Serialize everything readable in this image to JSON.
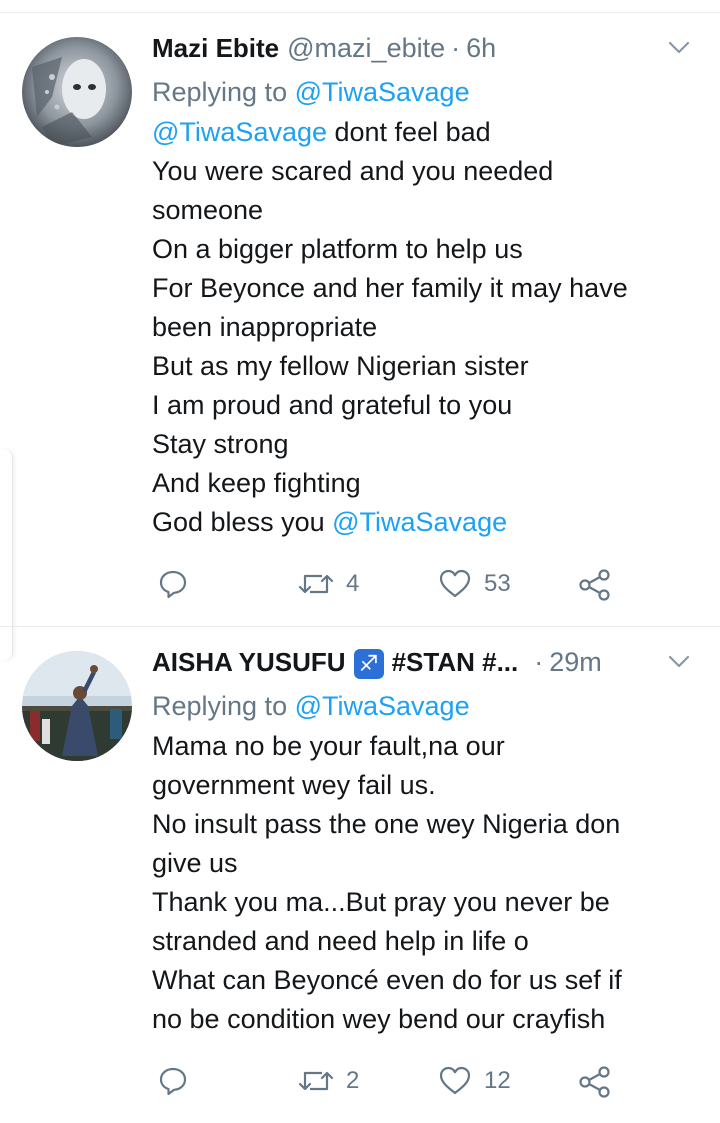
{
  "tweets": [
    {
      "name": "Mazi Ebite",
      "handle": "@mazi_ebite",
      "dot": "·",
      "time": "6h",
      "reply_prefix": "Replying to ",
      "reply_handle": "@TiwaSavage",
      "lines": [
        {
          "mention": "@TiwaSavage",
          "text": " dont feel bad"
        },
        {
          "text": "You were scared and you needed"
        },
        {
          "text": "someone"
        },
        {
          "text": "On a bigger platform to help us"
        },
        {
          "text": "For Beyonce and her family it may have"
        },
        {
          "text": "been inappropriate"
        },
        {
          "text": "But as my fellow Nigerian sister"
        },
        {
          "text": "I am proud and grateful to you"
        },
        {
          "text": "Stay strong"
        },
        {
          "text": "And keep fighting"
        },
        {
          "text": "God bless you ",
          "mention_after": "@TiwaSavage"
        }
      ],
      "retweets": "4",
      "likes": "53"
    },
    {
      "name": "AISHA YUSUFU",
      "name_badge": "♐",
      "name_suffix": "#STAN #...",
      "dot": "·",
      "time": "29m",
      "reply_prefix": "Replying to ",
      "reply_handle": "@TiwaSavage",
      "lines": [
        {
          "text": "Mama no be your fault,na our"
        },
        {
          "text": "government wey fail us."
        },
        {
          "text": "No insult pass the one wey Nigeria don"
        },
        {
          "text": "give us"
        },
        {
          "text": "Thank you ma...But pray you never be"
        },
        {
          "text": "stranded and need help in life o"
        },
        {
          "text": "What can Beyoncé even do for us sef if"
        },
        {
          "text": "no be condition wey bend our crayfish"
        }
      ],
      "retweets": "2",
      "likes": "12"
    }
  ],
  "colors": {
    "link": "#1da1f2",
    "muted": "#657786",
    "text": "#14171a"
  }
}
